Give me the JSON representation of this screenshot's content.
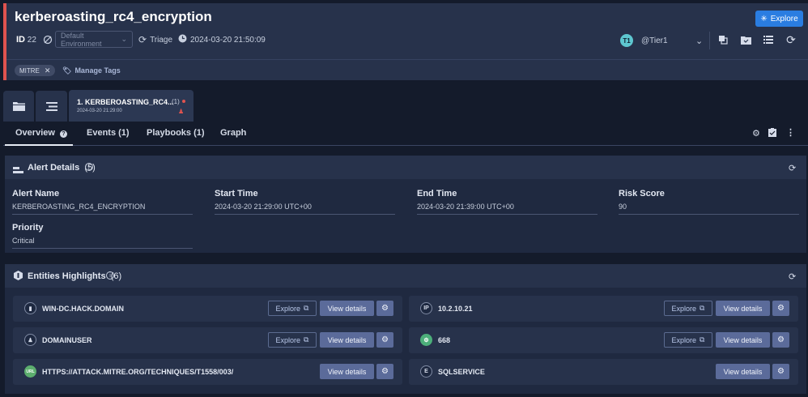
{
  "header": {
    "title": "kerberoasting_rc4_encryption",
    "explore_label": "Explore",
    "id_label": "ID",
    "id_value": "22",
    "environment_placeholder": "Default Environment",
    "stage": "Triage",
    "datetime": "2024-03-20 21:50:09",
    "assignee_initials": "T1",
    "assignee": "@Tier1",
    "accent_color": "#e0534f",
    "tags": [
      {
        "label": "MITRE"
      }
    ],
    "manage_tags_label": "Manage Tags"
  },
  "alert_tab": {
    "title": "1. KERBEROASTING_RC4...",
    "count": "(1)",
    "time": "2024-03-20 21:29:00"
  },
  "nav": {
    "tabs": [
      {
        "label": "Overview"
      },
      {
        "label": "Events (1)"
      },
      {
        "label": "Playbooks (1)"
      },
      {
        "label": "Graph"
      }
    ]
  },
  "alert_details": {
    "title": "Alert Details",
    "count": "(5)",
    "fields": [
      {
        "label": "Alert Name",
        "value": "KERBEROASTING_RC4_ENCRYPTION"
      },
      {
        "label": "Start Time",
        "value": "2024-03-20 21:29:00 UTC+00"
      },
      {
        "label": "End Time",
        "value": "2024-03-20 21:39:00 UTC+00"
      },
      {
        "label": "Risk Score",
        "value": "90"
      },
      {
        "label": "Priority",
        "value": "Critical"
      }
    ]
  },
  "entities": {
    "title": "Entities Highlights",
    "count": "(6)",
    "explore_label": "Explore",
    "view_label": "View details",
    "items": [
      {
        "name": "WIN-DC.HACK.DOMAIN",
        "icon": "host-icon",
        "has_explore": true
      },
      {
        "name": "10.2.10.21",
        "icon": "ip-icon",
        "has_explore": true
      },
      {
        "name": "DOMAINUSER",
        "icon": "user-icon",
        "has_explore": true
      },
      {
        "name": "668",
        "icon": "process-icon",
        "has_explore": true
      },
      {
        "name": "HTTPS://ATTACK.MITRE.ORG/TECHNIQUES/T1558/003/",
        "icon": "url-icon",
        "has_explore": false
      },
      {
        "name": "SQLSERVICE",
        "icon": "service-icon",
        "has_explore": false
      }
    ]
  }
}
